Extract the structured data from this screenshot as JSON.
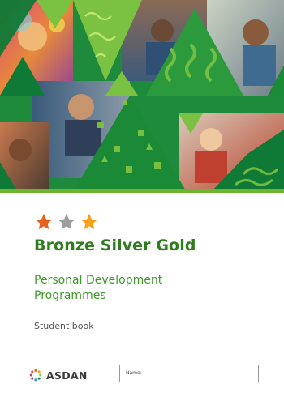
{
  "cover": {
    "title": "Bronze Silver Gold",
    "subtitle_line1": "Personal Development",
    "subtitle_line2": "Programmes",
    "book_type": "Student book",
    "publisher": "ASDAN",
    "name_label": "Name:",
    "stars": [
      {
        "medal": "bronze",
        "color": "#e8611d"
      },
      {
        "medal": "silver",
        "color": "#9d9d9d"
      },
      {
        "medal": "gold",
        "color": "#f4a11c"
      }
    ],
    "colors": {
      "title_green": "#2f7d1e",
      "subtitle_green": "#3e9b2a",
      "rule_green": "#6cb52d",
      "pattern_dark_green": "#0f7a35",
      "pattern_light_green": "#7cc242"
    }
  }
}
